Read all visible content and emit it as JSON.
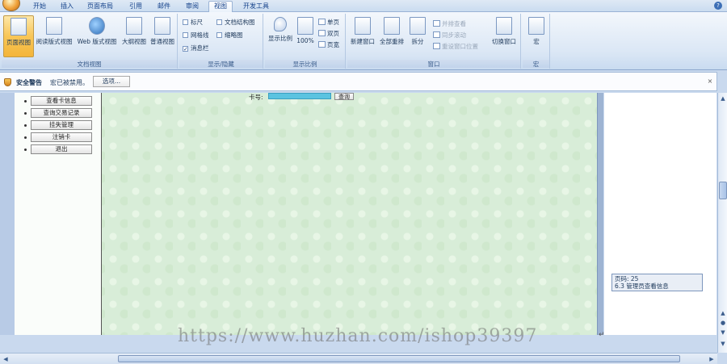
{
  "tabs": [
    {
      "label": "开始"
    },
    {
      "label": "插入"
    },
    {
      "label": "页面布局"
    },
    {
      "label": "引用"
    },
    {
      "label": "邮件"
    },
    {
      "label": "审阅"
    },
    {
      "label": "视图",
      "active": true
    },
    {
      "label": "开发工具"
    }
  ],
  "ribbon": {
    "doc_views": {
      "label": "文档视图",
      "buttons": [
        "页面视图",
        "阅读版式视图",
        "Web 版式视图",
        "大纲视图",
        "普通视图"
      ]
    },
    "show_hide": {
      "label": "显示/隐藏",
      "checks": [
        {
          "label": "标尺",
          "checked": false
        },
        {
          "label": "网格线",
          "checked": false
        },
        {
          "label": "消息栏",
          "checked": true
        },
        {
          "label": "文档结构图",
          "checked": false
        },
        {
          "label": "缩略图",
          "checked": false
        }
      ]
    },
    "zoom": {
      "label": "显示比例",
      "zoom_btn": "显示比例",
      "percent_btn": "100%",
      "one_page": "单页",
      "two_pages": "双页",
      "page_width": "页宽"
    },
    "window": {
      "label": "窗口",
      "new_window": "新建窗口",
      "arrange_all": "全部重排",
      "split": "拆分",
      "side_by_side": "并排查看",
      "sync_scroll": "同步滚动",
      "reset_position": "重设窗口位置",
      "switch_window": "切换窗口"
    },
    "macro": {
      "label": "宏",
      "button": "宏"
    }
  },
  "security_bar": {
    "title": "安全警告",
    "message": "宏已被禁用。",
    "options_button": "选项..."
  },
  "webpage": {
    "nav_buttons": [
      "查看卡信息",
      "查询交易记录",
      "挂失管理",
      "注销卡",
      "退出"
    ],
    "card_label": "卡号:",
    "query_button": "查询"
  },
  "status_tooltip": {
    "line1": "页码: 25",
    "line2": "6.3 管理员查看信息"
  },
  "watermark": "https://www.huzhan.com/ishop39397",
  "colors": {
    "ribbon_bg": "#dbe7f5",
    "active_view": "#f8c657",
    "page_bg": "#d8edd8",
    "card_input": "#5bc3e0"
  }
}
